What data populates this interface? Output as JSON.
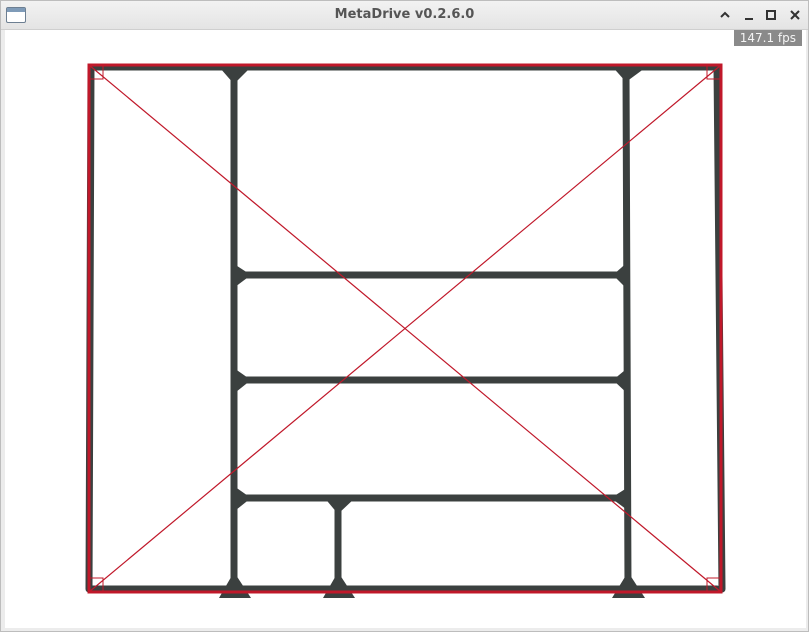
{
  "window": {
    "title": "MetaDrive v0.2.6.0",
    "controls": [
      "minimize-up",
      "minimize",
      "maximize",
      "close"
    ]
  },
  "viewport": {
    "fps_label": "147.1 fps",
    "background": "#ffffff",
    "road_color": "#3b403f",
    "boundary_color": "#c0182a"
  },
  "colors": {
    "titlebar": "#e8e8e8",
    "title_text": "#555555",
    "fps_badge": "#8a8a8a"
  }
}
